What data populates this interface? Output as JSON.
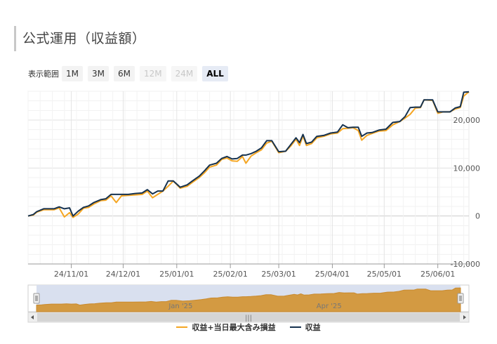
{
  "page": {
    "title": "公式運用（収益額）"
  },
  "range_selector": {
    "label": "表示範囲",
    "buttons": [
      {
        "label": "1M",
        "state": "normal"
      },
      {
        "label": "3M",
        "state": "normal"
      },
      {
        "label": "6M",
        "state": "normal"
      },
      {
        "label": "12M",
        "state": "disabled"
      },
      {
        "label": "24M",
        "state": "disabled"
      },
      {
        "label": "ALL",
        "state": "active"
      }
    ]
  },
  "navigator": {
    "labels": [
      "Jan '25",
      "Apr '25"
    ],
    "handle_glyph": "|||"
  },
  "colors": {
    "series_a": "#f5a623",
    "series_b": "#16324f",
    "navigator_fill": "#d39a42",
    "navigator_bg": "#d9e0ef"
  },
  "chart_data": {
    "type": "line",
    "x_axis": {
      "tick_labels": [
        "24/11/01",
        "24/12/01",
        "25/01/01",
        "25/02/01",
        "25/03/01",
        "25/04/01",
        "25/05/01",
        "25/06/01"
      ],
      "range": [
        "2024-10-07",
        "2025-06-19"
      ]
    },
    "y_axis": {
      "tick_labels": [
        "-10,000",
        "0",
        "10,000",
        "20,000"
      ],
      "ticks": [
        -10000,
        0,
        10000,
        20000
      ],
      "range": [
        -10000,
        26000
      ]
    },
    "legend": [
      "収益+当日最大含み損益",
      "収益"
    ],
    "series": [
      {
        "name": "収益+当日最大含み損益",
        "points": [
          [
            "2024-10-07",
            0
          ],
          [
            "2024-10-10",
            200
          ],
          [
            "2024-10-12",
            800
          ],
          [
            "2024-10-16",
            1300
          ],
          [
            "2024-10-22",
            1300
          ],
          [
            "2024-10-25",
            1700
          ],
          [
            "2024-10-28",
            -200
          ],
          [
            "2024-10-31",
            700
          ],
          [
            "2024-11-02",
            -300
          ],
          [
            "2024-11-05",
            400
          ],
          [
            "2024-11-08",
            1600
          ],
          [
            "2024-11-11",
            1800
          ],
          [
            "2024-11-14",
            2500
          ],
          [
            "2024-11-18",
            3200
          ],
          [
            "2024-11-21",
            3300
          ],
          [
            "2024-11-24",
            4200
          ],
          [
            "2024-11-27",
            2800
          ],
          [
            "2024-11-30",
            4200
          ],
          [
            "2024-12-04",
            4300
          ],
          [
            "2024-12-08",
            4400
          ],
          [
            "2024-12-12",
            4500
          ],
          [
            "2024-12-15",
            5200
          ],
          [
            "2024-12-18",
            3800
          ],
          [
            "2024-12-21",
            4500
          ],
          [
            "2024-12-24",
            5200
          ],
          [
            "2024-12-27",
            6200
          ],
          [
            "2024-12-30",
            7300
          ],
          [
            "2025-01-03",
            5800
          ],
          [
            "2025-01-07",
            6200
          ],
          [
            "2025-01-10",
            7000
          ],
          [
            "2025-01-14",
            8000
          ],
          [
            "2025-01-17",
            9000
          ],
          [
            "2025-01-20",
            10200
          ],
          [
            "2025-01-24",
            10600
          ],
          [
            "2025-01-27",
            11800
          ],
          [
            "2025-01-30",
            12100
          ],
          [
            "2025-02-02",
            11500
          ],
          [
            "2025-02-05",
            11400
          ],
          [
            "2025-02-08",
            12400
          ],
          [
            "2025-02-10",
            11000
          ],
          [
            "2025-02-13",
            12500
          ],
          [
            "2025-02-16",
            13200
          ],
          [
            "2025-02-19",
            13800
          ],
          [
            "2025-02-22",
            15200
          ],
          [
            "2025-02-25",
            15600
          ],
          [
            "2025-03-01",
            13200
          ],
          [
            "2025-03-05",
            13500
          ],
          [
            "2025-03-08",
            14600
          ],
          [
            "2025-03-11",
            16000
          ],
          [
            "2025-03-13",
            14700
          ],
          [
            "2025-03-15",
            16700
          ],
          [
            "2025-03-17",
            14700
          ],
          [
            "2025-03-20",
            15100
          ],
          [
            "2025-03-23",
            16300
          ],
          [
            "2025-03-27",
            16600
          ],
          [
            "2025-03-31",
            17100
          ],
          [
            "2025-04-04",
            17300
          ],
          [
            "2025-04-07",
            18200
          ],
          [
            "2025-04-10",
            18300
          ],
          [
            "2025-04-13",
            18400
          ],
          [
            "2025-04-16",
            17800
          ],
          [
            "2025-04-18",
            15800
          ],
          [
            "2025-04-21",
            16800
          ],
          [
            "2025-04-24",
            17200
          ],
          [
            "2025-04-28",
            17700
          ],
          [
            "2025-05-02",
            17800
          ],
          [
            "2025-05-06",
            19000
          ],
          [
            "2025-05-10",
            19700
          ],
          [
            "2025-05-13",
            20400
          ],
          [
            "2025-05-16",
            21200
          ],
          [
            "2025-05-19",
            22500
          ],
          [
            "2025-05-22",
            22600
          ],
          [
            "2025-05-24",
            24200
          ],
          [
            "2025-05-29",
            24100
          ],
          [
            "2025-06-01",
            21400
          ],
          [
            "2025-06-04",
            21700
          ],
          [
            "2025-06-08",
            21700
          ],
          [
            "2025-06-11",
            22300
          ],
          [
            "2025-06-14",
            22600
          ],
          [
            "2025-06-16",
            25000
          ],
          [
            "2025-06-19",
            25900
          ]
        ]
      },
      {
        "name": "収益",
        "points": [
          [
            "2024-10-07",
            0
          ],
          [
            "2024-10-10",
            300
          ],
          [
            "2024-10-12",
            900
          ],
          [
            "2024-10-16",
            1500
          ],
          [
            "2024-10-22",
            1500
          ],
          [
            "2024-10-25",
            1900
          ],
          [
            "2024-10-28",
            1500
          ],
          [
            "2024-10-31",
            1700
          ],
          [
            "2024-11-02",
            0
          ],
          [
            "2024-11-05",
            1000
          ],
          [
            "2024-11-08",
            1800
          ],
          [
            "2024-11-11",
            2100
          ],
          [
            "2024-11-14",
            2800
          ],
          [
            "2024-11-18",
            3400
          ],
          [
            "2024-11-21",
            3600
          ],
          [
            "2024-11-24",
            4500
          ],
          [
            "2024-11-27",
            4500
          ],
          [
            "2024-11-30",
            4500
          ],
          [
            "2024-12-04",
            4500
          ],
          [
            "2024-12-08",
            4700
          ],
          [
            "2024-12-12",
            4800
          ],
          [
            "2024-12-15",
            5500
          ],
          [
            "2024-12-18",
            4600
          ],
          [
            "2024-12-21",
            5200
          ],
          [
            "2024-12-24",
            5200
          ],
          [
            "2024-12-27",
            7300
          ],
          [
            "2024-12-30",
            7300
          ],
          [
            "2025-01-03",
            6000
          ],
          [
            "2025-01-07",
            6500
          ],
          [
            "2025-01-10",
            7300
          ],
          [
            "2025-01-14",
            8300
          ],
          [
            "2025-01-17",
            9400
          ],
          [
            "2025-01-20",
            10600
          ],
          [
            "2025-01-24",
            11000
          ],
          [
            "2025-01-27",
            12000
          ],
          [
            "2025-01-30",
            12400
          ],
          [
            "2025-02-02",
            11900
          ],
          [
            "2025-02-05",
            12000
          ],
          [
            "2025-02-08",
            12700
          ],
          [
            "2025-02-10",
            12700
          ],
          [
            "2025-02-13",
            13000
          ],
          [
            "2025-02-16",
            13500
          ],
          [
            "2025-02-19",
            14200
          ],
          [
            "2025-02-22",
            15700
          ],
          [
            "2025-02-25",
            15700
          ],
          [
            "2025-03-01",
            13400
          ],
          [
            "2025-03-05",
            13500
          ],
          [
            "2025-03-08",
            14900
          ],
          [
            "2025-03-11",
            16300
          ],
          [
            "2025-03-13",
            15300
          ],
          [
            "2025-03-15",
            17000
          ],
          [
            "2025-03-17",
            15100
          ],
          [
            "2025-03-20",
            15400
          ],
          [
            "2025-03-23",
            16600
          ],
          [
            "2025-03-27",
            16800
          ],
          [
            "2025-03-31",
            17300
          ],
          [
            "2025-04-04",
            17500
          ],
          [
            "2025-04-07",
            19000
          ],
          [
            "2025-04-10",
            18400
          ],
          [
            "2025-04-13",
            18500
          ],
          [
            "2025-04-16",
            18500
          ],
          [
            "2025-04-18",
            16600
          ],
          [
            "2025-04-21",
            17300
          ],
          [
            "2025-04-24",
            17400
          ],
          [
            "2025-04-28",
            17900
          ],
          [
            "2025-05-02",
            18100
          ],
          [
            "2025-05-06",
            19500
          ],
          [
            "2025-05-10",
            19700
          ],
          [
            "2025-05-13",
            20700
          ],
          [
            "2025-05-16",
            22600
          ],
          [
            "2025-05-19",
            22700
          ],
          [
            "2025-05-22",
            22700
          ],
          [
            "2025-05-24",
            24200
          ],
          [
            "2025-05-29",
            24200
          ],
          [
            "2025-06-01",
            21700
          ],
          [
            "2025-06-04",
            21700
          ],
          [
            "2025-06-08",
            21700
          ],
          [
            "2025-06-11",
            22500
          ],
          [
            "2025-06-14",
            22800
          ],
          [
            "2025-06-16",
            25800
          ],
          [
            "2025-06-19",
            25900
          ]
        ]
      }
    ]
  }
}
